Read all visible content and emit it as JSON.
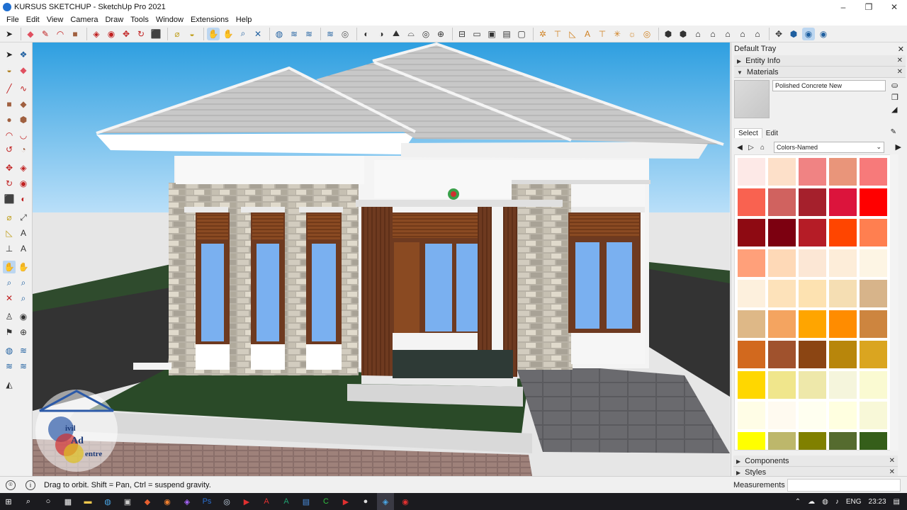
{
  "window": {
    "title": "KURSUS SKETCHUP - SketchUp Pro 2021",
    "controls": [
      "–",
      "❐",
      "✕"
    ]
  },
  "menu": [
    "File",
    "Edit",
    "View",
    "Camera",
    "Draw",
    "Tools",
    "Window",
    "Extensions",
    "Help"
  ],
  "tray": {
    "title": "Default Tray",
    "entity_info": "Entity Info",
    "materials": "Materials",
    "material_name": "Polished Concrete New",
    "tab_select": "Select",
    "tab_edit": "Edit",
    "library": "Colors-Named",
    "components": "Components",
    "styles": "Styles",
    "swatches": [
      "#fde9e7",
      "#fde0c9",
      "#f08383",
      "#e9957a",
      "#f77a7a",
      "#f96250",
      "#d0625f",
      "#a5202c",
      "#dc143c",
      "#ff0000",
      "#8e0a12",
      "#7c0010",
      "#b51c26",
      "#ff4500",
      "#ff7f50",
      "#ffa07a",
      "#fed9b7",
      "#fce7d5",
      "#fdedd9",
      "#fdf5e4",
      "#fdf0dd",
      "#fde2ba",
      "#fde2b1",
      "#f5deb3",
      "#d7b48a",
      "#deb887",
      "#f4a460",
      "#ffa500",
      "#ff8c00",
      "#cd853f",
      "#d2691e",
      "#a0522d",
      "#8b4513",
      "#b8860b",
      "#daa520",
      "#ffd700",
      "#f0e68c",
      "#eee8aa",
      "#f5f5dc",
      "#fafad2",
      "#fffde6",
      "#fffaf0",
      "#fffff0",
      "#ffffe0",
      "#f8f8d8",
      "#ffff00",
      "#bdb76b",
      "#808000",
      "#556b2f",
      "#355e1a"
    ]
  },
  "status": {
    "hint": "Drag to orbit. Shift = Pan, Ctrl = suspend gravity.",
    "measurements_label": "Measurements"
  },
  "taskbar": {
    "language": "ENG",
    "time": "23:23"
  },
  "watermark": {
    "line1": "ivil",
    "line2": "Ad",
    "line3": "entre"
  }
}
